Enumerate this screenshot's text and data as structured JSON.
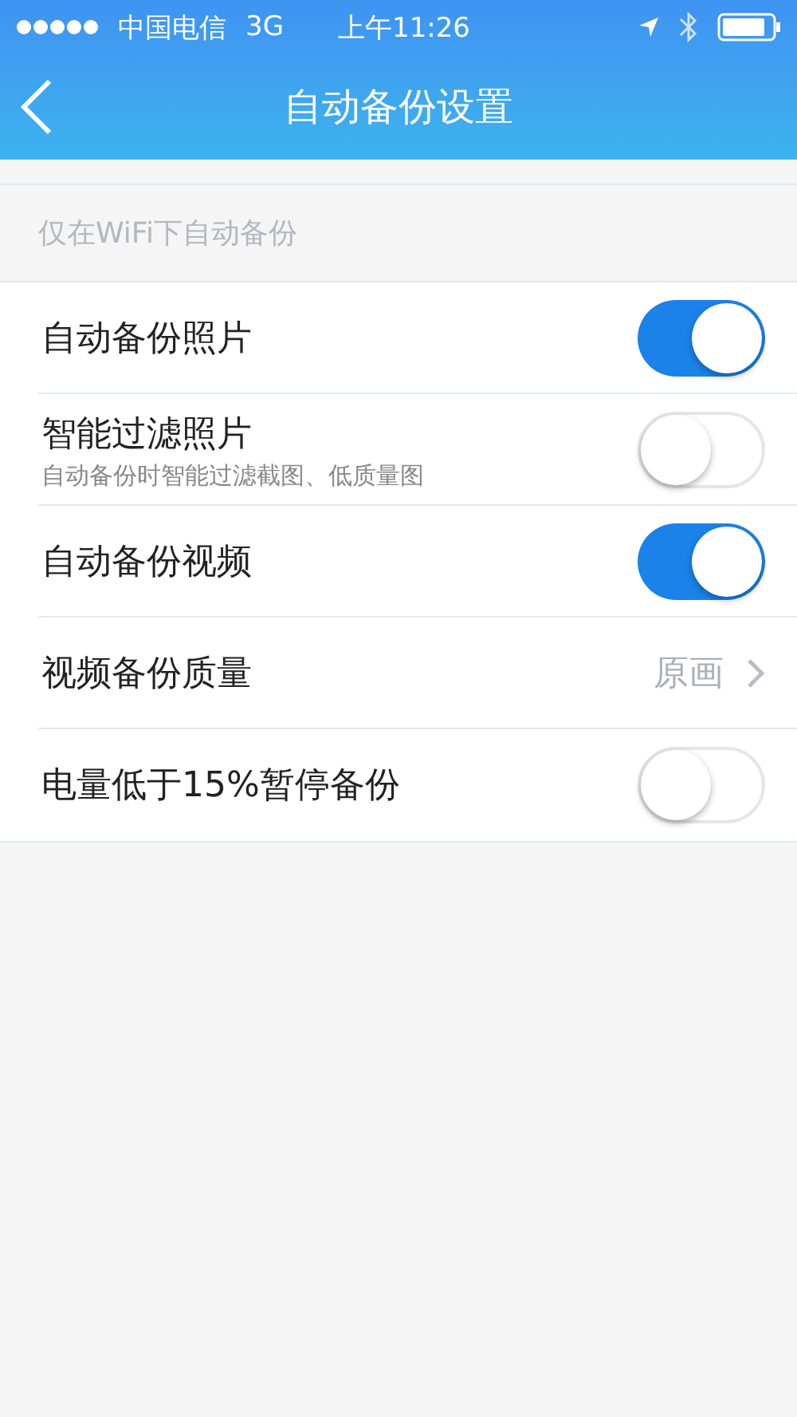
{
  "status_bar": {
    "carrier": "中国电信",
    "network": "3G",
    "time": "上午11:26"
  },
  "nav_bar": {
    "title": "自动备份设置"
  },
  "section_header": "仅在WiFi下自动备份",
  "settings": [
    {
      "kind": "toggle",
      "label": "自动备份照片",
      "on": true
    },
    {
      "kind": "toggle",
      "label": "智能过滤照片",
      "subtitle": "自动备份时智能过滤截图、低质量图",
      "on": false
    },
    {
      "kind": "toggle",
      "label": "自动备份视频",
      "on": true
    },
    {
      "kind": "value",
      "label": "视频备份质量",
      "value": "原画"
    },
    {
      "kind": "toggle",
      "label": "电量低于15%暂停备份",
      "on": false
    }
  ]
}
